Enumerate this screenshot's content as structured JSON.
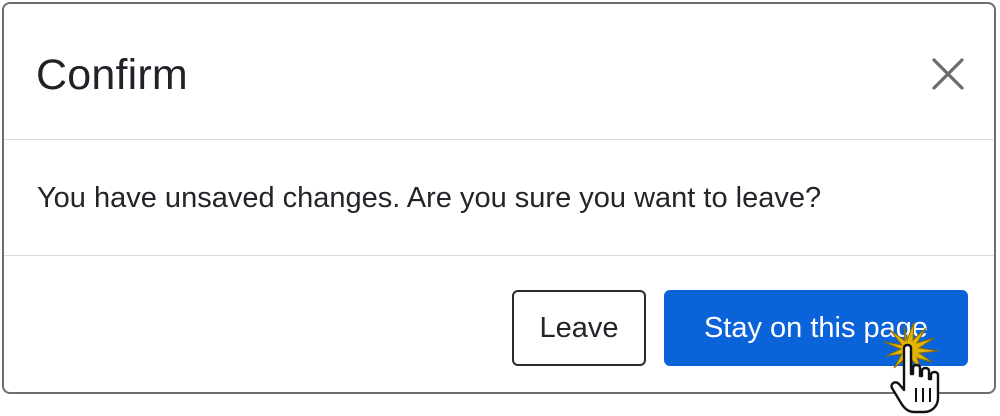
{
  "dialog": {
    "title": "Confirm",
    "message": "You have unsaved changes. Are you sure you want to leave?",
    "close_icon": "close-icon",
    "buttons": {
      "leave_label": "Leave",
      "stay_label": "Stay on this page"
    }
  },
  "colors": {
    "primary": "#0a63d9",
    "title_text": "#1f2328",
    "border": "#6e6e6e",
    "divider": "#dcdcdc"
  },
  "cursor": {
    "icon": "hand-pointer-icon",
    "click_burst": "click-burst-icon"
  }
}
